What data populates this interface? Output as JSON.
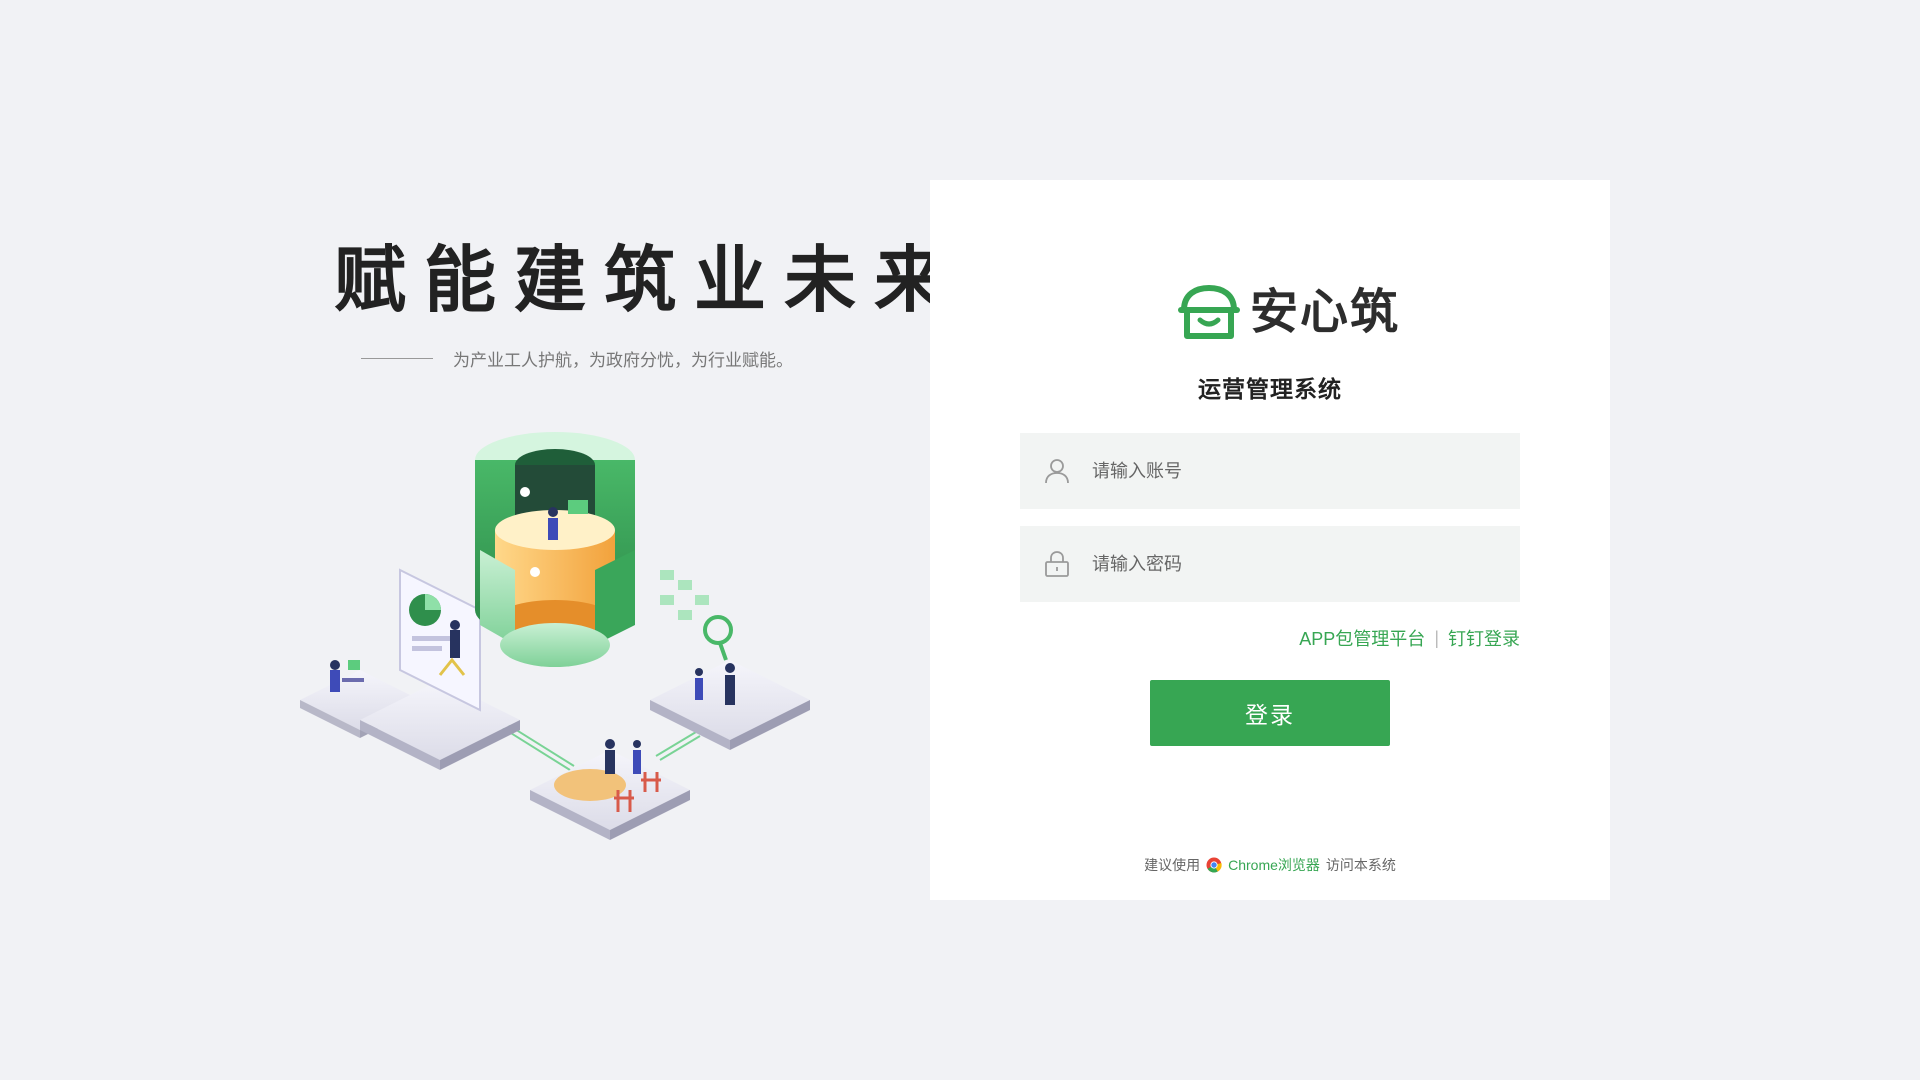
{
  "hero": {
    "slogan": "赋能建筑业未来",
    "tagline": "为产业工人护航，为政府分忧，为行业赋能。"
  },
  "brand": {
    "name": "安心筑",
    "system_title": "运营管理系统",
    "accent_color": "#37a653"
  },
  "login_form": {
    "account_placeholder": "请输入账号",
    "password_placeholder": "请输入密码",
    "app_link": "APP包管理平台",
    "separator": "|",
    "dingtalk_link": "钉钉登录",
    "submit_label": "登录"
  },
  "footer": {
    "prefix": "建议使用",
    "browser_icon": "chrome-icon",
    "browser_name": "Chrome浏览器",
    "suffix": "访问本系统"
  }
}
